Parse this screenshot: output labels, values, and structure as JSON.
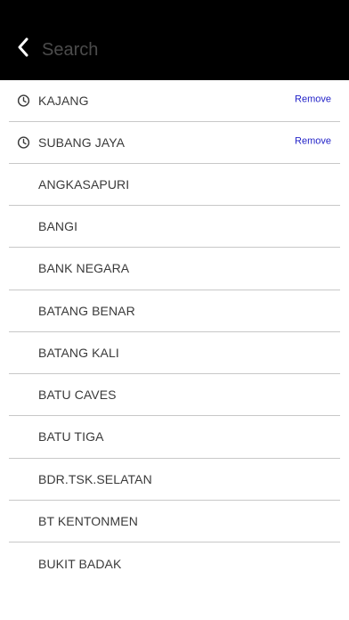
{
  "header": {
    "search_placeholder": "Search",
    "back_icon": "chevron-left-icon"
  },
  "recent_label_remove": "Remove",
  "recent_searches": [
    {
      "label": "KAJANG",
      "icon": "clock-icon",
      "action": "Remove"
    },
    {
      "label": "SUBANG JAYA",
      "icon": "clock-icon",
      "action": "Remove"
    }
  ],
  "stations": [
    {
      "label": "ANGKASAPURI"
    },
    {
      "label": "BANGI"
    },
    {
      "label": "BANK NEGARA"
    },
    {
      "label": "BATANG BENAR"
    },
    {
      "label": "BATANG KALI"
    },
    {
      "label": "BATU CAVES"
    },
    {
      "label": "BATU TIGA"
    },
    {
      "label": "BDR.TSK.SELATAN"
    },
    {
      "label": "BT KENTONMEN"
    },
    {
      "label": "BUKIT BADAK"
    }
  ],
  "colors": {
    "header_bg": "#000000",
    "remove_link": "#2323c8",
    "divider": "#c8c8c8",
    "text": "#3a3a3a"
  }
}
